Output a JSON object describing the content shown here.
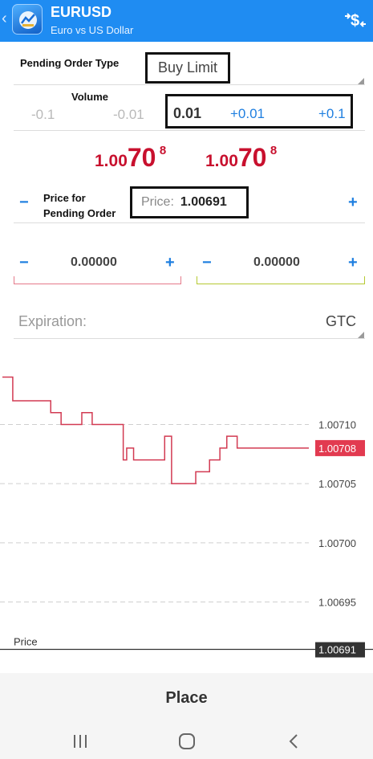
{
  "header": {
    "symbol": "EURUSD",
    "description": "Euro vs US Dollar"
  },
  "order": {
    "type_label": "Pending Order Type",
    "type_value": "Buy Limit",
    "volume_label": "Volume",
    "volume_steps_minus": [
      "-0.1",
      "-0.01"
    ],
    "volume_value": "0.01",
    "volume_steps_plus": [
      "+0.01",
      "+0.1"
    ],
    "quotes": [
      {
        "prefix": "1.00",
        "main": "70",
        "sup": "8"
      },
      {
        "prefix": "1.00",
        "main": "70",
        "sup": "8"
      }
    ],
    "pending_price_label_line1": "Price for",
    "pending_price_label_line2": "Pending Order",
    "price_placeholder": "Price:",
    "price_value": "1.00691",
    "stop_loss_value": "0.00000",
    "take_profit_value": "0.00000",
    "minus": "−",
    "plus": "+",
    "expiration_label": "Expiration:",
    "expiration_value": "GTC"
  },
  "chart_data": {
    "type": "line",
    "x": [
      0,
      1,
      2,
      3,
      4,
      5,
      6,
      7,
      8,
      9,
      10,
      11,
      12,
      13,
      14,
      15,
      16,
      17,
      18,
      19,
      20,
      21,
      22,
      23,
      24,
      25,
      26,
      27,
      28,
      29,
      30,
      31,
      32,
      33,
      34,
      35,
      36,
      37,
      38,
      39,
      40,
      41,
      42,
      43,
      44,
      45,
      46,
      47,
      48,
      49,
      50,
      51,
      52,
      53,
      54,
      55,
      56,
      57,
      58,
      59,
      60,
      61,
      62,
      63,
      64,
      65,
      66,
      67,
      68,
      69,
      70,
      71,
      72,
      73,
      74,
      75,
      76,
      77,
      78,
      79
    ],
    "series": [
      {
        "values": [
          1.00714,
          1.00714,
          1.00714,
          1.00712,
          1.00712,
          1.00712,
          1.00712,
          1.00712,
          1.00712,
          1.00712,
          1.00712,
          1.00712,
          1.00712,
          1.00712,
          1.00711,
          1.00711,
          1.00711,
          1.0071,
          1.0071,
          1.0071,
          1.0071,
          1.0071,
          1.0071,
          1.00711,
          1.00711,
          1.00711,
          1.0071,
          1.0071,
          1.0071,
          1.0071,
          1.0071,
          1.0071,
          1.0071,
          1.0071,
          1.0071,
          1.00707,
          1.00708,
          1.00708,
          1.00707,
          1.00707,
          1.00707,
          1.00707,
          1.00707,
          1.00707,
          1.00707,
          1.00707,
          1.00707,
          1.00709,
          1.00709,
          1.00705,
          1.00705,
          1.00705,
          1.00705,
          1.00705,
          1.00705,
          1.00705,
          1.00706,
          1.00706,
          1.00706,
          1.00706,
          1.00707,
          1.00707,
          1.00707,
          1.00708,
          1.00708,
          1.00709,
          1.00709,
          1.00709,
          1.00708,
          1.00708,
          1.00708,
          1.00708,
          1.00708,
          1.00708,
          1.00708,
          1.00708,
          1.00708,
          1.00708,
          1.00708,
          1.00708
        ]
      }
    ],
    "y_ticks": [
      "1.00710",
      "1.00705",
      "1.00700",
      "1.00695"
    ],
    "ylim": [
      1.00689,
      1.00716
    ],
    "current_price": {
      "value": 1.00708,
      "label": "1.00708"
    },
    "pending_line": {
      "value": 1.00691,
      "label": "1.00691",
      "name": "Price"
    },
    "grid": true
  },
  "actions": {
    "place_label": "Place"
  },
  "colors": {
    "accent": "#1f8cf2",
    "price_red": "#c8102e",
    "chart_line": "#d23a52",
    "current_price_bg": "#e23a50",
    "pending_label_bg": "#333333"
  }
}
